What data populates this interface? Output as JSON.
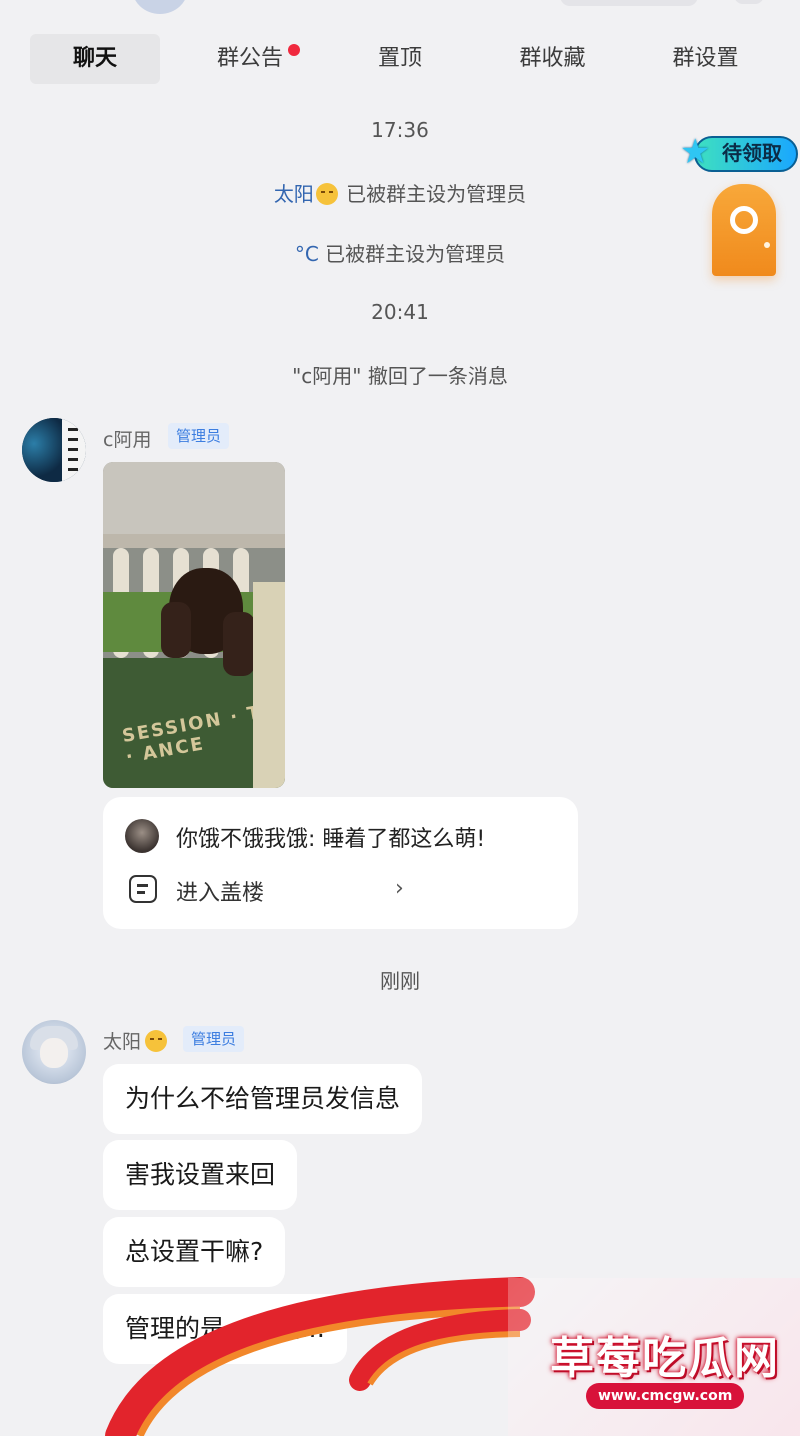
{
  "tabs": [
    {
      "label": "聊天",
      "active": true
    },
    {
      "label": "群公告",
      "has_dot": true
    },
    {
      "label": "置顶"
    },
    {
      "label": "群收藏"
    },
    {
      "label": "群设置"
    }
  ],
  "system": {
    "time1": "17:36",
    "admin1_name": "太阳",
    "admin1_text": "已被群主设为管理员",
    "admin2_name": "°C",
    "admin2_text": "已被群主设为管理员",
    "time2": "20:41",
    "recall_text": "\"c阿用\" 撤回了一条消息",
    "time3": "刚刚"
  },
  "badge": {
    "label": "待领取",
    "icon": "star-icon"
  },
  "msg1": {
    "sender": "c阿用",
    "role": "管理员",
    "photo_caption": "SESSION · TH · ANCE",
    "card": {
      "quote": "你饿不饿我饿: 睡着了都这么萌!",
      "thread_label": "进入盖楼",
      "chevron": "›"
    }
  },
  "msg2": {
    "sender": "太阳",
    "role": "管理员",
    "bubbles": [
      "为什么不给管理员发信息",
      "害我设置来回",
      "总设置干嘛?",
      "管理的是…还是…"
    ]
  },
  "watermark": {
    "title": "草莓吃瓜网",
    "url": "www.cmcgw.com"
  },
  "colors": {
    "name_link": "#3366b0",
    "role_text": "#3d7ee0",
    "role_bg": "#e3ecfa",
    "red_dot": "#f0293e",
    "ribbon_red": "#e2242c",
    "ribbon_orange": "#f2872a"
  }
}
